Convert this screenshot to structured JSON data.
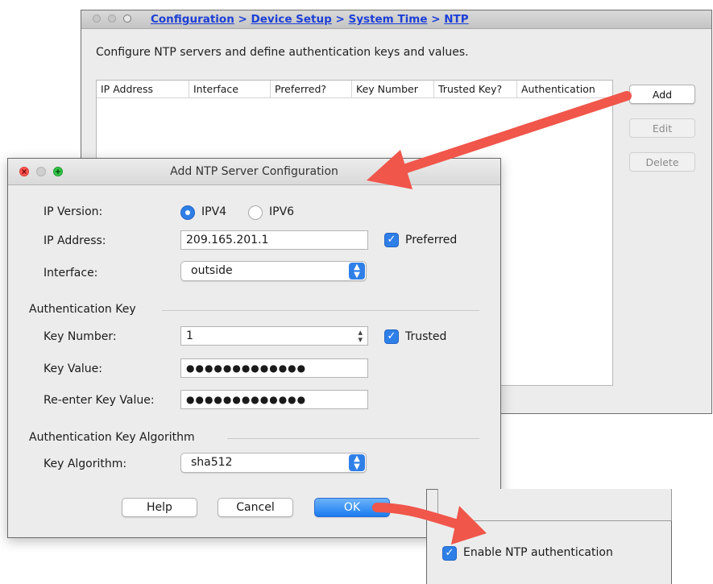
{
  "config_window": {
    "breadcrumb": {
      "part1": "Configuration",
      "sep1": ">",
      "part2": "Device Setup",
      "sep2": ">",
      "part3": "System Time",
      "sep3": ">",
      "part4": "NTP"
    },
    "description": "Configure NTP servers and define authentication keys and values.",
    "table_columns": [
      "IP Address",
      "Interface",
      "Preferred?",
      "Key Number",
      "Trusted Key?",
      "Authentication"
    ],
    "buttons": {
      "add": "Add",
      "edit": "Edit",
      "delete": "Delete"
    }
  },
  "dialog": {
    "title": "Add NTP Server Configuration",
    "ip_version": {
      "label": "IP Version:",
      "options": [
        "IPV4",
        "IPV6"
      ],
      "selected": "IPV4"
    },
    "ip_address": {
      "label": "IP Address:",
      "value": "209.165.201.1"
    },
    "preferred": {
      "label": "Preferred",
      "checked": true
    },
    "interface": {
      "label": "Interface:",
      "value": "outside"
    },
    "auth_key_section": "Authentication Key",
    "key_number": {
      "label": "Key Number:",
      "value": "1"
    },
    "trusted": {
      "label": "Trusted",
      "checked": true
    },
    "key_value": {
      "label": "Key Value:",
      "value": "●●●●●●●●●●●●●"
    },
    "reenter_key_value": {
      "label": "Re-enter Key Value:",
      "value": "●●●●●●●●●●●●●"
    },
    "algo_section": "Authentication Key Algorithm",
    "key_algorithm": {
      "label": "Key Algorithm:",
      "value": "sha512"
    },
    "buttons": {
      "help": "Help",
      "cancel": "Cancel",
      "ok": "OK"
    }
  },
  "inset": {
    "enable_auth": {
      "label": "Enable NTP authentication",
      "checked": true
    }
  },
  "colors": {
    "accent": "#2f7fe8",
    "link": "#1d3fd6",
    "arrow": "#f0564a"
  }
}
